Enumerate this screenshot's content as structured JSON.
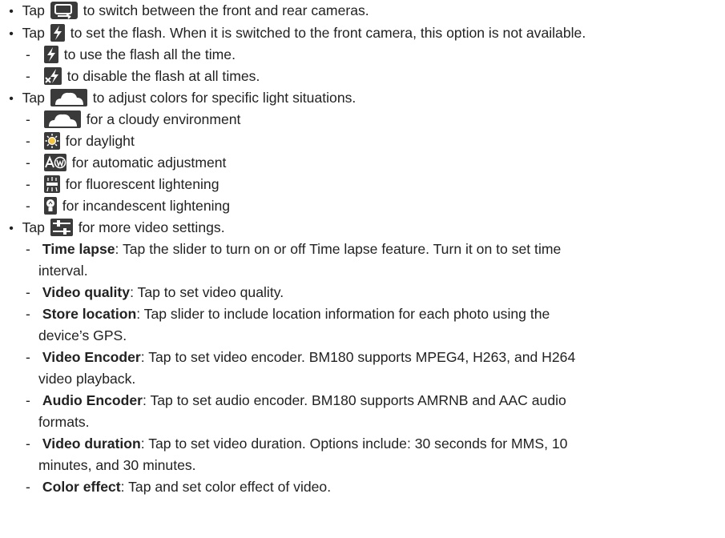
{
  "items": {
    "camera_switch": {
      "prefix": "Tap",
      "suffix": "to switch between the front and rear cameras."
    },
    "flash": {
      "prefix": "Tap",
      "suffix": "to set the flash. When it is switched to the front camera, this option is not available.",
      "sub": [
        "to use the flash all the time.",
        "to disable the flash at all times."
      ]
    },
    "white_balance": {
      "prefix": "Tap",
      "suffix": "to adjust colors for specific light situations.",
      "sub": [
        "for a cloudy environment",
        "for daylight",
        "for automatic adjustment",
        "for fluorescent lightening",
        "for incandescent lightening"
      ]
    },
    "video_settings": {
      "prefix": "Tap",
      "suffix": "for more video settings.",
      "sub": [
        {
          "term": "Time lapse",
          "text": ": Tap the slider to turn on or off Time lapse feature. Turn it on to set time",
          "cont": "interval."
        },
        {
          "term": "Video quality",
          "text": ": Tap to set video quality."
        },
        {
          "term": "Store location",
          "text": ": Tap slider to include location information for each photo using the",
          "cont": "device’s GPS."
        },
        {
          "term": "Video Encoder",
          "text": ": Tap to set video encoder. BM180 supports MPEG4, H263, and H264",
          "cont": "video playback."
        },
        {
          "term": "Audio Encoder",
          "text": ": Tap to set audio encoder. BM180 supports AMRNB and AAC audio",
          "cont": "formats."
        },
        {
          "term": "Video duration",
          "text": ": Tap to set video duration. Options include: 30 seconds for MMS, 10",
          "cont": "minutes, and 30 minutes."
        },
        {
          "term": "Color effect",
          "text": ": Tap and set color effect of video."
        }
      ]
    }
  },
  "icons": {
    "camera_switch": "camera-switch-icon",
    "flash_on": "flash-on-icon",
    "flash_off": "flash-off-icon",
    "cloudy": "cloudy-icon",
    "daylight": "daylight-icon",
    "auto_wb": "auto-white-balance-icon",
    "fluorescent": "fluorescent-icon",
    "incandescent": "incandescent-icon",
    "settings": "settings-sliders-icon"
  },
  "colors": {
    "text": "#222222",
    "icon_bg": "#3a3a3a"
  },
  "glyphs": {
    "bullet": "•",
    "dash": "-"
  }
}
